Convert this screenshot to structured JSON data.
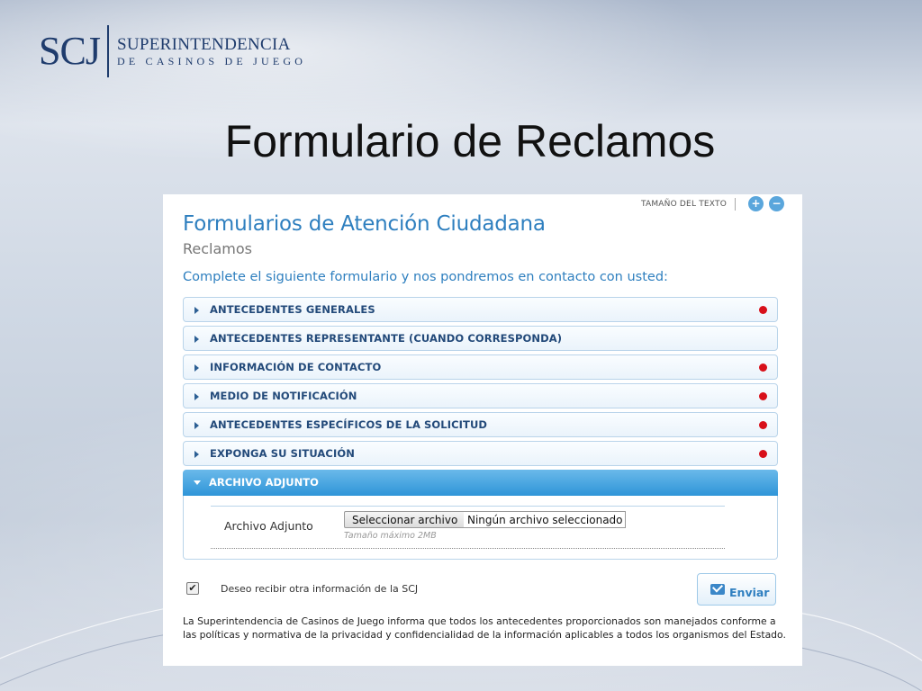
{
  "logo": {
    "mark": "SCJ",
    "line1": "SUPERINTENDENCIA",
    "line2": "DE CASINOS DE JUEGO"
  },
  "slide_title": "Formulario de Reclamos",
  "screenshot": {
    "text_size": {
      "label": "TAMAÑO DEL TEXTO",
      "increase": "+",
      "decrease": "−"
    },
    "title": "Formularios de Atención Ciudadana",
    "subtitle": "Reclamos",
    "intro": "Complete el siguiente formulario y nos pondremos en contacto con usted:",
    "sections": [
      {
        "label": "ANTECEDENTES GENERALES",
        "required": true
      },
      {
        "label": "ANTECEDENTES REPRESENTANTE (CUANDO CORRESPONDA)",
        "required": false
      },
      {
        "label": "INFORMACIÓN DE CONTACTO",
        "required": true
      },
      {
        "label": "MEDIO DE NOTIFICACIÓN",
        "required": true
      },
      {
        "label": "ANTECEDENTES ESPECÍFICOS DE LA SOLICITUD",
        "required": true
      },
      {
        "label": "EXPONGA SU SITUACIÓN",
        "required": true
      }
    ],
    "open_section": {
      "label": "ARCHIVO ADJUNTO",
      "field_label": "Archivo Adjunto",
      "file_button": "Seleccionar archivo",
      "file_status": "Ningún archivo seleccionado",
      "hint": "Tamaño máximo 2MB"
    },
    "checkbox": {
      "checked": true,
      "mark": "✔",
      "label": "Deseo recibir otra información de la SCJ"
    },
    "send_button": "Enviar",
    "disclaimer": "La Superintendencia de Casinos de Juego informa que todos los antecedentes proporcionados son manejados conforme a las políticas y normativa de la privacidad y confidencialidad de la información aplicables a todos los organismos del Estado."
  },
  "colors": {
    "brand_navy": "#1f3c6d",
    "form_blue": "#2e7fbf",
    "required_dot": "#d8101a",
    "open_section": "#2f95d8"
  }
}
